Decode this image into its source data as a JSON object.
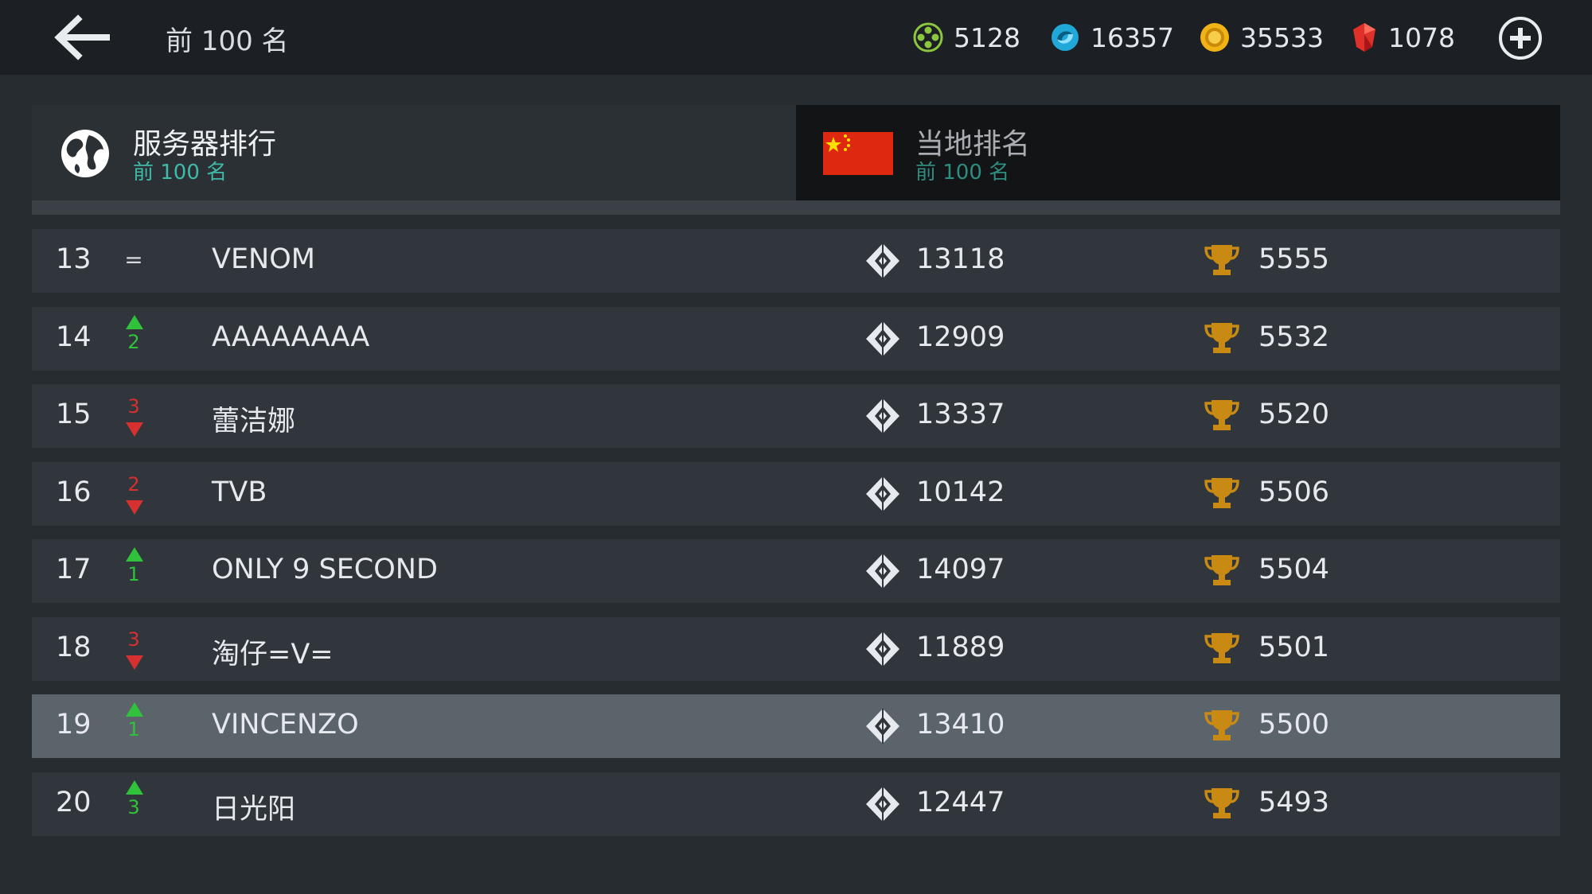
{
  "header": {
    "title": "前 100 名",
    "back_icon": "back-arrow-icon",
    "add_icon": "plus-circle-icon"
  },
  "resources": [
    {
      "icon": "green-token-icon",
      "value": "5128",
      "color": "#8cc63f"
    },
    {
      "icon": "blue-swirl-icon",
      "value": "16357",
      "color": "#1fa8d8"
    },
    {
      "icon": "gold-coin-icon",
      "value": "35533",
      "color": "#f2b316"
    },
    {
      "icon": "red-gem-icon",
      "value": "1078",
      "color": "#e0302a"
    }
  ],
  "tabs": {
    "server": {
      "title": "服务器排行",
      "subtitle": "前 100 名",
      "icon": "globe-icon"
    },
    "local": {
      "title": "当地排名",
      "subtitle": "前 100 名",
      "icon": "china-flag-icon"
    }
  },
  "colors": {
    "accent_teal": "#3fb9a8",
    "up_green": "#31c23c",
    "down_red": "#d63030",
    "trophy_gold": "#c88a12"
  },
  "rows": [
    {
      "rank": "13",
      "change": {
        "dir": "same",
        "label": "="
      },
      "name": "VENOM",
      "rating": "13118",
      "trophies": "5555"
    },
    {
      "rank": "14",
      "change": {
        "dir": "up",
        "label": "2"
      },
      "name": "AAAAAAAA",
      "rating": "12909",
      "trophies": "5532"
    },
    {
      "rank": "15",
      "change": {
        "dir": "down",
        "label": "3"
      },
      "name": "蕾洁娜",
      "rating": "13337",
      "trophies": "5520"
    },
    {
      "rank": "16",
      "change": {
        "dir": "down",
        "label": "2"
      },
      "name": "TVB",
      "rating": "10142",
      "trophies": "5506"
    },
    {
      "rank": "17",
      "change": {
        "dir": "up",
        "label": "1"
      },
      "name": "ONLY 9 SECOND",
      "rating": "14097",
      "trophies": "5504"
    },
    {
      "rank": "18",
      "change": {
        "dir": "down",
        "label": "3"
      },
      "name": "淘仔=V=",
      "rating": "11889",
      "trophies": "5501"
    },
    {
      "rank": "19",
      "change": {
        "dir": "up",
        "label": "1"
      },
      "name": "VINCENZO",
      "rating": "13410",
      "trophies": "5500",
      "highlight": true
    },
    {
      "rank": "20",
      "change": {
        "dir": "up",
        "label": "3"
      },
      "name": "日光阳",
      "rating": "12447",
      "trophies": "5493"
    }
  ]
}
